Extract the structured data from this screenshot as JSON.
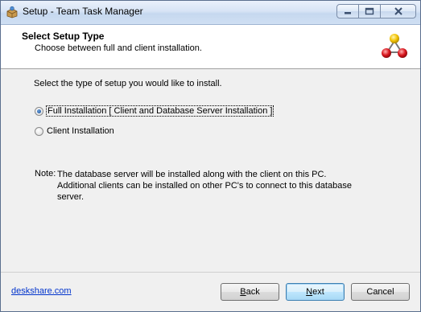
{
  "window": {
    "title": "Setup - Team Task Manager",
    "icon": "setup-package-icon"
  },
  "header": {
    "title": "Select Setup Type",
    "subtitle": "Choose between full and client installation.",
    "logo": "molecule-logo-icon"
  },
  "main": {
    "instruction": "Select the type of setup you would like to install.",
    "options": [
      {
        "label": "Full Installation [ Client and Database Server Installation ]",
        "checked": true
      },
      {
        "label": "Client Installation",
        "checked": false
      }
    ],
    "note_label": "Note:",
    "note_text": "The database server will be installed along with the client on this PC. Additional clients can be installed on other PC's to connect to this database server."
  },
  "footer": {
    "link": "deskshare.com",
    "back_prefix": "",
    "back_accel": "B",
    "back_rest": "ack",
    "next_prefix": "",
    "next_accel": "N",
    "next_rest": "ext",
    "cancel_label": "Cancel"
  },
  "colors": {
    "link": "#0033cc",
    "radio_dot": "#1f5aa5",
    "logo_top": "#f2c200",
    "logo_bottom": "#d8141c"
  }
}
